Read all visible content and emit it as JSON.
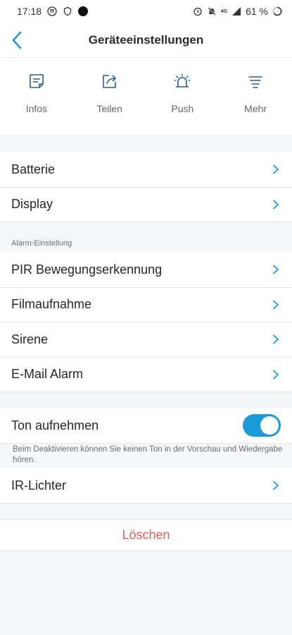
{
  "status": {
    "time": "17:18",
    "network": "4G",
    "battery": "61 %"
  },
  "header": {
    "title": "Geräteeinstellungen"
  },
  "quick_actions": [
    {
      "label": "Infos",
      "icon": "info-card-icon"
    },
    {
      "label": "Teilen",
      "icon": "share-icon"
    },
    {
      "label": "Push",
      "icon": "alarm-bell-icon"
    },
    {
      "label": "Mehr",
      "icon": "menu-lines-icon"
    }
  ],
  "general": {
    "items": [
      "Batterie",
      "Display"
    ]
  },
  "alarm": {
    "section_label": "Alarm-Einstellung",
    "items": [
      "PIR Bewegungserkennung",
      "Filmaufnahme",
      "Sirene",
      "E-Mail Alarm"
    ]
  },
  "audio": {
    "record_label": "Ton aufnehmen",
    "record_enabled": true,
    "note": "Beim Deaktivieren können Sie keinen Ton in der Vorschau und Wiedergabe hören.",
    "ir_label": "IR-Lichter"
  },
  "actions": {
    "delete_label": "Löschen"
  },
  "colors": {
    "accent": "#1a9ad8",
    "danger": "#e8585e",
    "background": "#f5f6f8"
  }
}
